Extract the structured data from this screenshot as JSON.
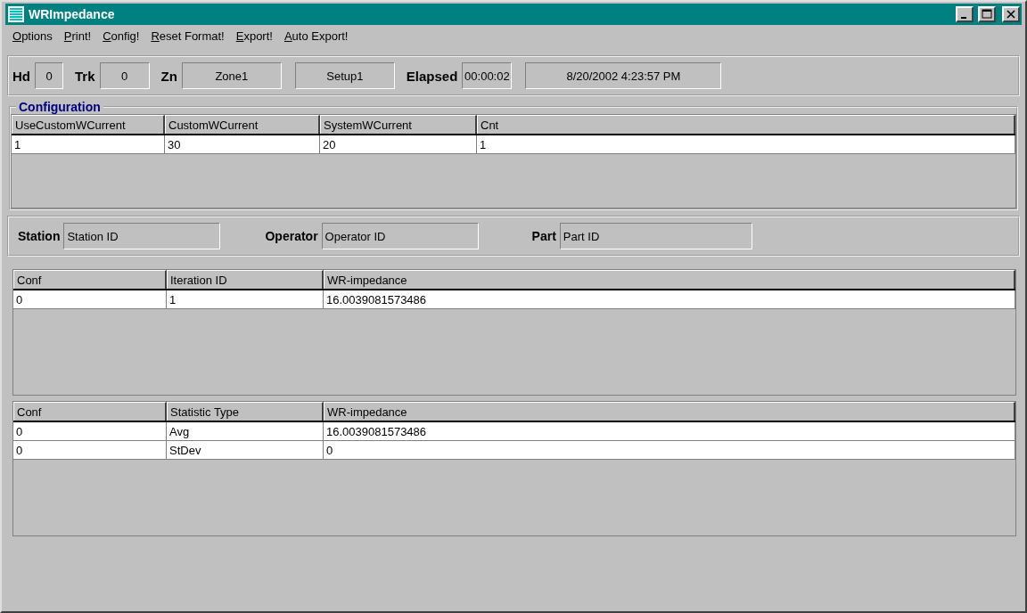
{
  "window": {
    "title": "WRImpedance"
  },
  "menu": [
    "Options",
    "Print!",
    "Config!",
    "Reset Format!",
    "Export!",
    "Auto Export!"
  ],
  "header": {
    "fields": [
      {
        "label": "Hd",
        "value": "0",
        "kind": "narrow"
      },
      {
        "label": "Trk",
        "value": "0",
        "kind": "medium"
      },
      {
        "label": "Zn",
        "value": "Zone1",
        "kind": "wide"
      },
      {
        "value": "Setup1",
        "kind": "wide"
      },
      {
        "label": "Elapsed",
        "value": "00:00:02",
        "kind": "medium"
      },
      {
        "value": "8/20/2002 4:23:57 PM",
        "kind": "xwide"
      }
    ]
  },
  "configuration": {
    "title": "Configuration",
    "columns": [
      "UseCustomWCurrent",
      "CustomWCurrent",
      "SystemWCurrent",
      "Cnt"
    ],
    "rows": [
      [
        "1",
        "30",
        "20",
        "1"
      ]
    ]
  },
  "ids": [
    {
      "label": "Station",
      "value": "Station ID"
    },
    {
      "label": "Operator",
      "value": "Operator ID"
    },
    {
      "label": "Part",
      "value": "Part ID"
    }
  ],
  "iterations": {
    "columns": [
      "Conf",
      "Iteration ID",
      "WR-impedance"
    ],
    "rows": [
      [
        "0",
        "1",
        "16.0039081573486"
      ]
    ]
  },
  "statistics": {
    "columns": [
      "Conf",
      "Statistic Type",
      "WR-impedance"
    ],
    "rows": [
      [
        "0",
        "Avg",
        "16.0039081573486"
      ],
      [
        "0",
        "StDev",
        "0"
      ]
    ]
  }
}
